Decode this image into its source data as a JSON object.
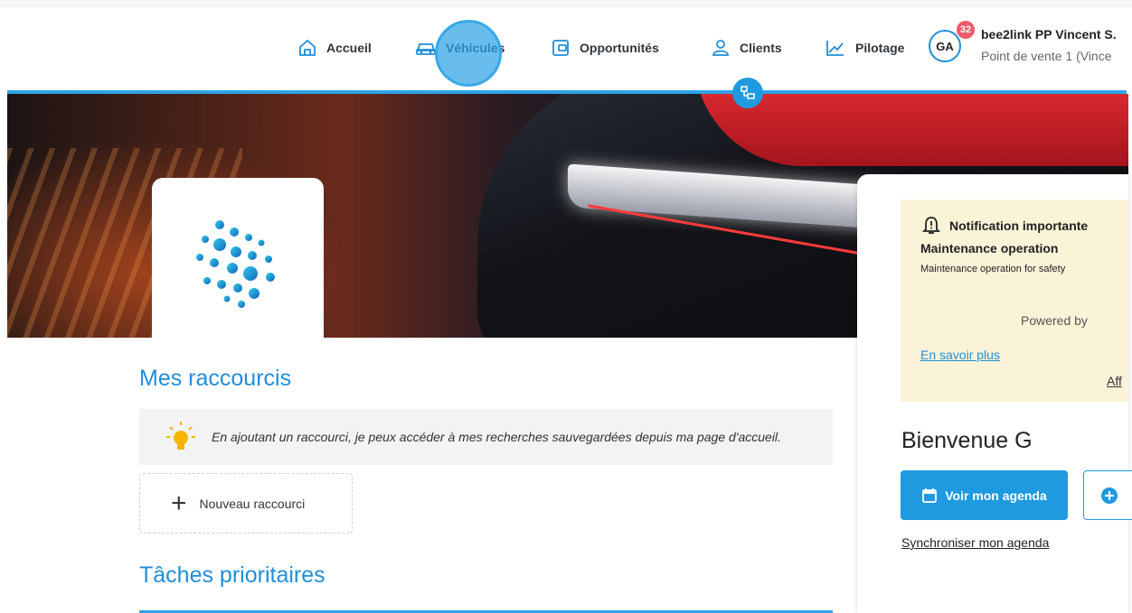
{
  "nav": {
    "items": [
      {
        "label": "Accueil",
        "icon": "home-icon"
      },
      {
        "label": "Véhicules",
        "icon": "car-icon"
      },
      {
        "label": "Opportunités",
        "icon": "wallet-icon"
      },
      {
        "label": "Clients",
        "icon": "user-icon"
      },
      {
        "label": "Pilotage",
        "icon": "chart-icon"
      }
    ],
    "accent_color": "#2ea3e6"
  },
  "user": {
    "initials": "GA",
    "notification_count": "32",
    "name": "bee2link PP Vincent S.",
    "store": "Point de vente 1 (Vince"
  },
  "network_button": {
    "icon": "network-icon"
  },
  "shortcuts": {
    "title": "Mes raccourcis",
    "tip_icon": "lightbulb-icon",
    "tip_text": "En ajoutant un raccourci, je peux accéder à mes recherches sauvegardées depuis ma page d'accueil.",
    "add_label": "Nouveau raccourci",
    "add_icon": "plus-icon"
  },
  "tasks": {
    "title": "Tâches prioritaires"
  },
  "notification": {
    "icon": "bell-alert-icon",
    "title": "Notification importante",
    "heading": "Maintenance operation",
    "body": "Maintenance operation for safety",
    "powered_by": "Powered by",
    "link": "En savoir plus",
    "aff_link": "Aff",
    "background": "#fbf3d8"
  },
  "welcome": {
    "text": "Bienvenue G",
    "agenda_button": "Voir mon agenda",
    "agenda_icon": "calendar-icon",
    "add_icon": "plus-circle-icon",
    "sync_link": "Synchroniser mon agenda"
  }
}
